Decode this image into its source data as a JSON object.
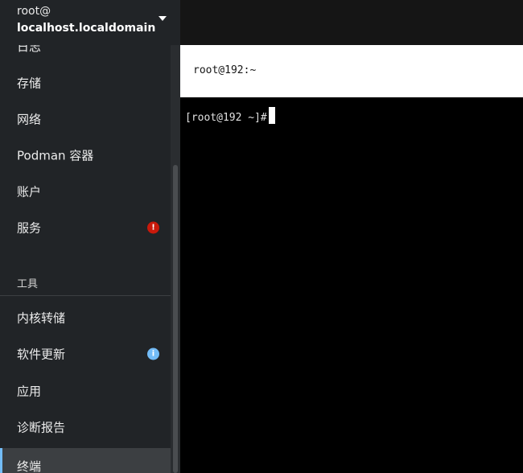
{
  "host": {
    "user": "root@",
    "name": "localhost.localdomain"
  },
  "nav": {
    "partial_item": "日志",
    "items": [
      "存储",
      "网络",
      "Podman 容器",
      "账户",
      "服务"
    ],
    "services_badge": "!",
    "tools_heading": "工具",
    "tools": [
      "内核转储",
      "软件更新",
      "应用",
      "诊断报告",
      "终端"
    ],
    "update_badge": "i"
  },
  "terminal": {
    "title": "root@192:~",
    "prompt": "[root@192 ~]# "
  },
  "colors": {
    "accent": "#73bcf7",
    "error": "#c9190b",
    "sidebar_bg": "#212427"
  }
}
